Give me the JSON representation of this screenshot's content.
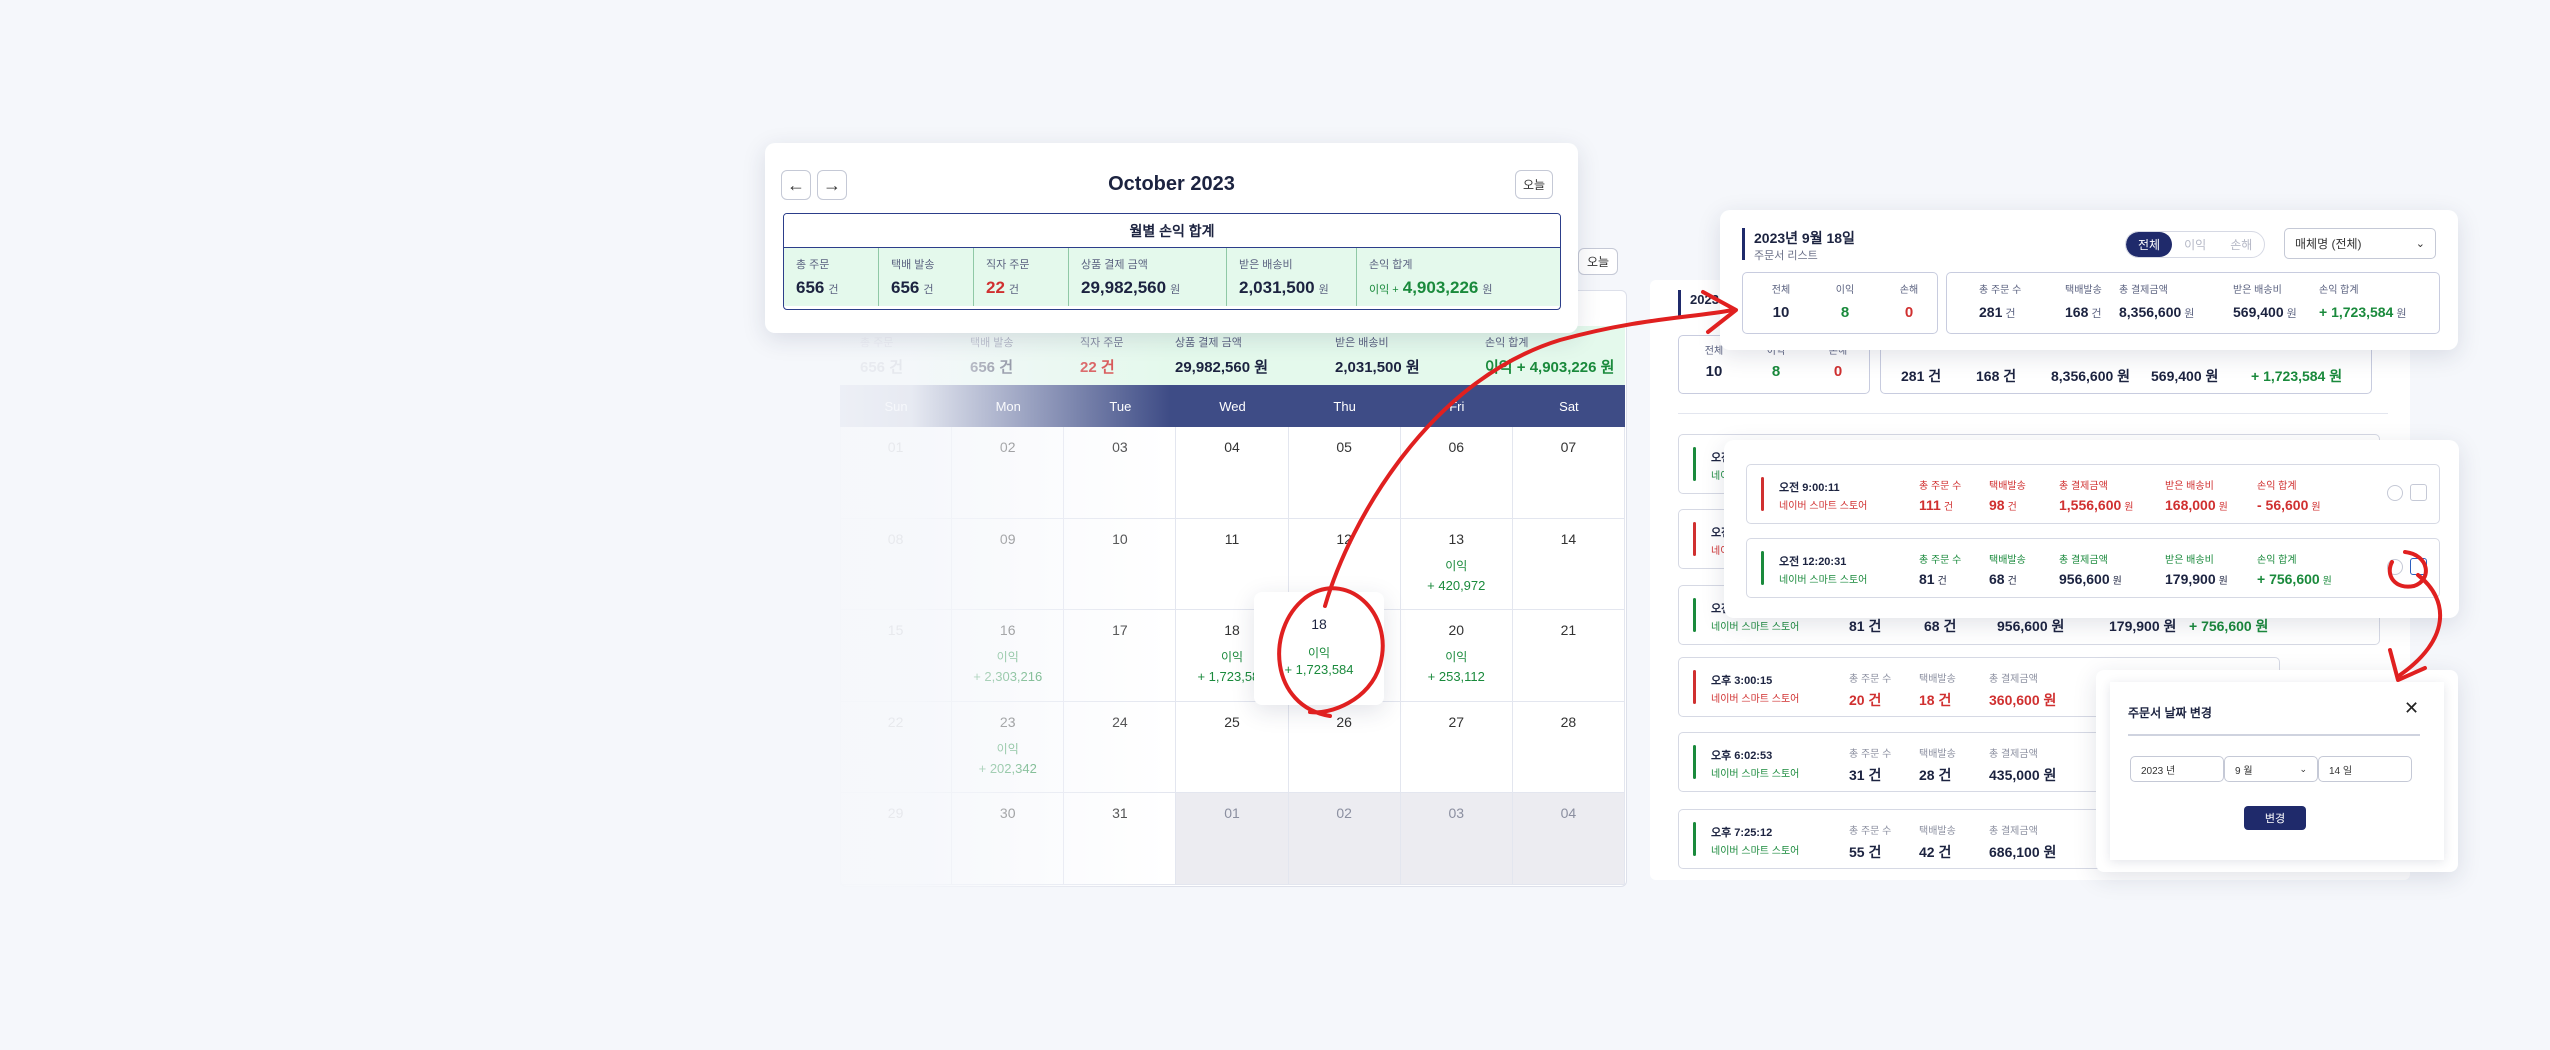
{
  "month_card": {
    "title": "October 2023",
    "prev_icon": "arrow-left-icon",
    "next_icon": "arrow-right-icon",
    "today_label": "오늘",
    "summary_title": "월별 손익 합계",
    "summary": [
      {
        "label": "총 주문",
        "value": "656",
        "unit": "건",
        "color": "#1c2340"
      },
      {
        "label": "택배 발송",
        "value": "656",
        "unit": "건",
        "color": "#1c2340"
      },
      {
        "label": "직자 주문",
        "value": "22",
        "unit": "건",
        "color": "#d03030"
      },
      {
        "label": "상품 결제 금액",
        "value": "29,982,560",
        "unit": "원",
        "color": "#1c2340"
      },
      {
        "label": "받은 배송비",
        "value": "2,031,500",
        "unit": "원",
        "color": "#1c2340"
      },
      {
        "label": "손익 합계",
        "prefix": "이익 +",
        "value": "4,903,226",
        "unit": "원",
        "color": "#1a8a3c"
      }
    ]
  },
  "background_summary": {
    "labels": [
      "총 주문",
      "택배 발송",
      "직자 주문",
      "상품 결제 금액",
      "받은 배송비",
      "손익 합계"
    ],
    "values": [
      "656 건",
      "656 건",
      "22 건",
      "29,982,560 원",
      "2,031,500 원",
      "이익 + 4,903,226 원"
    ]
  },
  "calendar": {
    "day_names": [
      "Sun",
      "Mon",
      "Tue",
      "Wed",
      "Thu",
      "Fri",
      "Sat"
    ],
    "cells": [
      {
        "d": "01"
      },
      {
        "d": "02"
      },
      {
        "d": "03"
      },
      {
        "d": "04"
      },
      {
        "d": "05"
      },
      {
        "d": "06"
      },
      {
        "d": "07"
      },
      {
        "d": "08"
      },
      {
        "d": "09"
      },
      {
        "d": "10"
      },
      {
        "d": "11"
      },
      {
        "d": "12"
      },
      {
        "d": "13",
        "t1": "이익",
        "t2": "+ 420,972"
      },
      {
        "d": "14"
      },
      {
        "d": "15"
      },
      {
        "d": "16",
        "t1": "이익",
        "t2": "+ 2,303,216"
      },
      {
        "d": "17"
      },
      {
        "d": "18",
        "t1": "이익",
        "t2": "+ 1,723,584"
      },
      {
        "d": "19"
      },
      {
        "d": "20",
        "t1": "이익",
        "t2": "+ 253,112"
      },
      {
        "d": "21"
      },
      {
        "d": "22"
      },
      {
        "d": "23",
        "t1": "이익",
        "t2": "+ 202,342"
      },
      {
        "d": "24"
      },
      {
        "d": "25"
      },
      {
        "d": "26"
      },
      {
        "d": "27"
      },
      {
        "d": "28"
      },
      {
        "d": "29"
      },
      {
        "d": "30"
      },
      {
        "d": "31"
      },
      {
        "d": "01",
        "gray": true
      },
      {
        "d": "02",
        "gray": true
      },
      {
        "d": "03",
        "gray": true
      },
      {
        "d": "04",
        "gray": true
      }
    ],
    "popup": {
      "day": "18",
      "label": "이익",
      "value": "+ 1,723,584"
    }
  },
  "day_card": {
    "title": "2023년 9월 18일",
    "subtitle": "주문서 리스트",
    "tabs": [
      "전체",
      "이익",
      "손해"
    ],
    "dropdown": "매체명 (전체)",
    "counts": [
      {
        "label": "전체",
        "value": "10",
        "color": "#1c2340"
      },
      {
        "label": "이익",
        "value": "8",
        "color": "#1a8a3c"
      },
      {
        "label": "손해",
        "value": "0",
        "color": "#d03030"
      }
    ],
    "totals": [
      {
        "label": "총 주문 수",
        "value": "281",
        "unit": "건",
        "color": "#1c2340"
      },
      {
        "label": "택배발송",
        "value": "168",
        "unit": "건",
        "color": "#1c2340"
      },
      {
        "label": "총 결제금액",
        "value": "8,356,600",
        "unit": "원",
        "color": "#1c2340"
      },
      {
        "label": "받은 배송비",
        "value": "569,400",
        "unit": "원",
        "color": "#1c2340"
      },
      {
        "label": "손익 합계",
        "value": "+ 1,723,584",
        "unit": "원",
        "color": "#1a8a3c"
      }
    ]
  },
  "bg_day": {
    "title": "2023",
    "today_label": "오늘",
    "counts": [
      "10",
      "8",
      "0"
    ],
    "count_labels": [
      "전체",
      "이익",
      "손해"
    ],
    "totals": [
      "281 건",
      "168 건",
      "8,356,600 원",
      "569,400 원",
      "+ 1,723,584 원"
    ]
  },
  "order_card": {
    "orders": [
      {
        "time": "오전 9:00:11",
        "store": "네이버 스마트 스토어",
        "color": "#d03030",
        "cols": [
          {
            "label": "총 주문 수",
            "value": "111",
            "unit": "건"
          },
          {
            "label": "택배발송",
            "value": "98",
            "unit": "건"
          },
          {
            "label": "총 결제금액",
            "value": "1,556,600",
            "unit": "원"
          },
          {
            "label": "받은 배송비",
            "value": "168,000",
            "unit": "원"
          },
          {
            "label": "손익 합계",
            "value": "- 56,600",
            "unit": "원"
          }
        ]
      },
      {
        "time": "오전 12:20:31",
        "store": "네이버 스마트 스토어",
        "color": "#1a8a3c",
        "cols": [
          {
            "label": "총 주문 수",
            "value": "81",
            "unit": "건"
          },
          {
            "label": "택배발송",
            "value": "68",
            "unit": "건"
          },
          {
            "label": "총 결제금액",
            "value": "956,600",
            "unit": "원"
          },
          {
            "label": "받은 배송비",
            "value": "179,900",
            "unit": "원"
          },
          {
            "label": "손익 합계",
            "value": "+ 756,600",
            "unit": "원"
          }
        ]
      }
    ]
  },
  "bg_orders": [
    {
      "time": "오전",
      "store": "네이",
      "color": "#1a8a3c",
      "values": []
    },
    {
      "time": "오전",
      "store": "네이",
      "color": "#d03030",
      "values": []
    },
    {
      "time": "오전",
      "store": "네이버 스마트 스토어",
      "color": "#1a8a3c",
      "values": [
        "81 건",
        "68 건",
        "956,600 원",
        "179,900 원",
        "+ 756,600 원"
      ]
    },
    {
      "time": "오후 3:00:15",
      "store": "네이버 스마트 스토어",
      "color": "#d03030",
      "labels": [
        "총 주문 수",
        "택배발송",
        "총 결제금액"
      ],
      "values": [
        "20 건",
        "18 건",
        "360,600 원"
      ]
    },
    {
      "time": "오후 6:02:53",
      "store": "네이버 스마트 스토어",
      "color": "#1a8a3c",
      "labels": [
        "총 주문 수",
        "택배발송",
        "총 결제금액"
      ],
      "values": [
        "31 건",
        "28 건",
        "435,000 원"
      ]
    },
    {
      "time": "오후 7:25:12",
      "store": "네이버 스마트 스토어",
      "color": "#1a8a3c",
      "labels": [
        "총 주문 수",
        "택배발송",
        "총 결제금액"
      ],
      "values": [
        "55 건",
        "42 건",
        "686,100 원"
      ]
    }
  ],
  "date_dialog": {
    "title": "주문서 날짜 변경",
    "close_icon": "close-icon",
    "year": "2023 년",
    "month": "9 월",
    "day": "14 일",
    "submit": "변경"
  },
  "colors": {
    "accent": "#1f2a6b",
    "profit": "#1a8a3c",
    "loss": "#d03030",
    "arrow": "#e02020",
    "summary_bg": "#e4f9ec"
  }
}
